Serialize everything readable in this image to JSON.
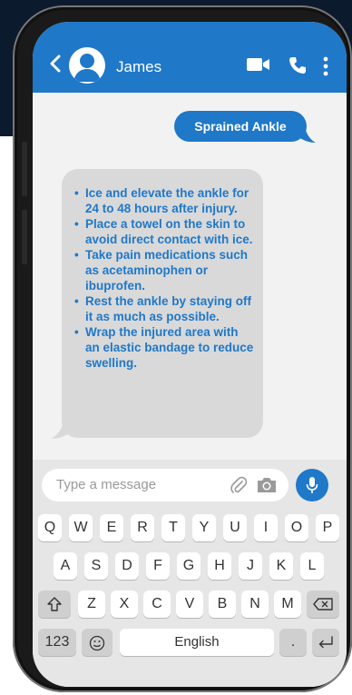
{
  "contact": {
    "name": "James"
  },
  "messages": {
    "sent": "Sprained Ankle",
    "reply": [
      "Ice and elevate the ankle for 24 to 48 hours after injury.",
      "Place a towel on the skin to avoid direct contact with ice.",
      "Take pain medications such as acetaminophen or ibuprofen.",
      "Rest the ankle by staying off it as much as possible.",
      "Wrap the injured area with an elastic bandage to reduce swelling."
    ]
  },
  "composer": {
    "placeholder": "Type a message"
  },
  "keyboard": {
    "row1": [
      "Q",
      "W",
      "E",
      "R",
      "T",
      "Y",
      "U",
      "I",
      "O",
      "P"
    ],
    "row2": [
      "A",
      "S",
      "D",
      "F",
      "G",
      "H",
      "J",
      "K",
      "L"
    ],
    "row3": [
      "Z",
      "X",
      "C",
      "V",
      "B",
      "N",
      "M"
    ],
    "numbers": "123",
    "space": "English",
    "period": "."
  },
  "colors": {
    "accent": "#1f78c8",
    "chat_bg": "#f2f2f2",
    "bubble_received": "#d9d9d9"
  }
}
